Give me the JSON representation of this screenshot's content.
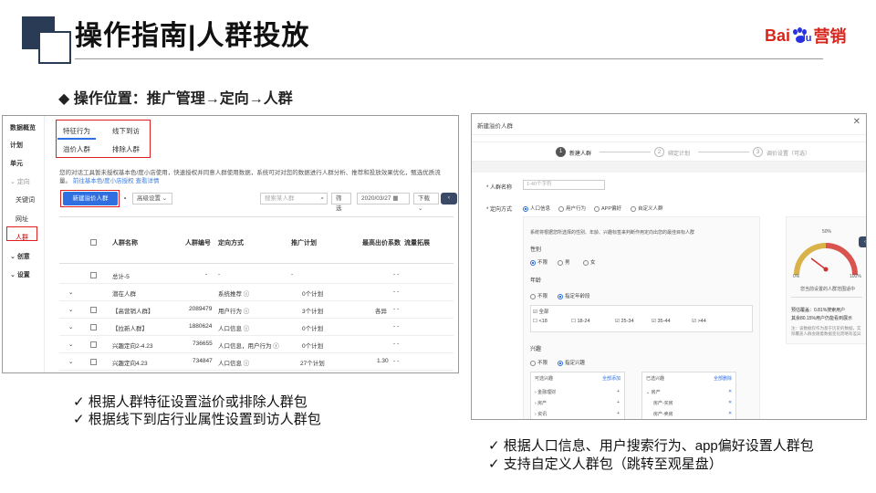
{
  "header": {
    "title": "操作指南|人群投放",
    "logo_bai": "Bai",
    "logo_du": "du",
    "logo_ying": "营销"
  },
  "subtitle": "◆ 操作位置：推广管理→定向→人群",
  "left_screen": {
    "sidenav": [
      "数据概览",
      "计划",
      "单元",
      "定向",
      "关键词",
      "网址",
      "人群",
      "创意",
      "设置"
    ],
    "tabs": [
      "特征行为",
      "线下到访",
      "溢价人群",
      "排除人群"
    ],
    "notice": "您的对话工具暂未授权基本色/度小店使用，快速授权并同意人群使用数据，系统可对对您的数据进行人群分析、推荐和投放效果优化，甄选优质流量。",
    "notice_link1": "前往基本色/度小店授权",
    "notice_link2": "查看详情",
    "new_button": "新建溢价人群",
    "adv_settings": "高级设置",
    "search_placeholder": "搜索某人群",
    "filter": "筛选",
    "date": "2020/03/27",
    "download": "下载",
    "headers": [
      "人群名称",
      "人群编号",
      "定向方式",
      "推广计划",
      "最高出价系数",
      "流量拓展"
    ],
    "rows": [
      {
        "name": "总计-5",
        "id": "-",
        "mode": "-",
        "plan": "-",
        "coef": "",
        "ext": "- -"
      },
      {
        "name": "潜在人群",
        "id": "-",
        "mode": "系统推荐 ⓘ",
        "plan": "0个计划",
        "coef": "",
        "ext": "- -"
      },
      {
        "name": "【高营销人群】",
        "id": "2089479",
        "mode": "用户行为 ⓘ",
        "plan": "3个计划",
        "coef": "各异",
        "ext": "- -"
      },
      {
        "name": "【拉新人群】",
        "id": "1880624",
        "mode": "人口信息 ⓘ",
        "plan": "0个计划",
        "coef": "",
        "ext": "- -"
      },
      {
        "name": "兴趣定向2-4.23",
        "id": "736655",
        "mode": "人口信息，用户行为 ⓘ",
        "plan": "0个计划",
        "coef": "",
        "ext": "- -"
      },
      {
        "name": "兴趣定向4.23",
        "id": "734847",
        "mode": "人口信息 ⓘ",
        "plan": "27个计划",
        "coef": "1.30",
        "ext": "- -"
      }
    ]
  },
  "right_screen": {
    "title": "新建溢价人群",
    "steps": [
      "新建人群",
      "绑定计划",
      "调价设置（可选）"
    ],
    "name_label": "* 人群名称",
    "name_placeholder": "1-40个字符",
    "mode_label": "* 定向方式",
    "modes": [
      "人口信息",
      "用户行为",
      "APP偏好",
      "自定义人群"
    ],
    "mode_desc": "系统将根据您所选择的性别、年龄、兴趣标签来判断作用定向出您的最佳目标人群",
    "gender_label": "性别",
    "gender_opts": [
      "不限",
      "男",
      "女"
    ],
    "age_label": "年龄",
    "age_opts": [
      "不限",
      "指定年龄段"
    ],
    "age_all": "全部",
    "ages": [
      "<18",
      "18-24",
      "25-34",
      "35-44",
      ">44"
    ],
    "interest_label": "兴趣",
    "interest_opts": [
      "不限",
      "指定兴趣"
    ],
    "avail_title": "可选兴趣",
    "avail_add": "全部添加",
    "avail_items": [
      "金融理财",
      "房产",
      "资讯"
    ],
    "sel_title": "已选兴趣",
    "sel_del": "全部删除",
    "sel_items": [
      "房产",
      "房产-买房",
      "房产-卖房"
    ],
    "gauge_top": "50%",
    "gauge_left": "0%",
    "gauge_right": "100%",
    "gauge_caption": "您当前设置的人群范围适中",
    "est1": "预估覆盖：0.81%搜索用户",
    "est2": "其余80.15%用户仍能看到展示",
    "note": "注：该数据仅作为基于历史的数据，实际覆盖人群会随着数据变化而略有差异"
  },
  "captions": {
    "left1": "✓ 根据人群特征设置溢价或排除人群包",
    "left2": "✓ 根据线下到店行业属性设置到访人群包",
    "right1": "✓ 根据人口信息、用户搜索行为、app偏好设置人群包",
    "right2": "✓ 支持自定义人群包（跳转至观星盘）"
  }
}
